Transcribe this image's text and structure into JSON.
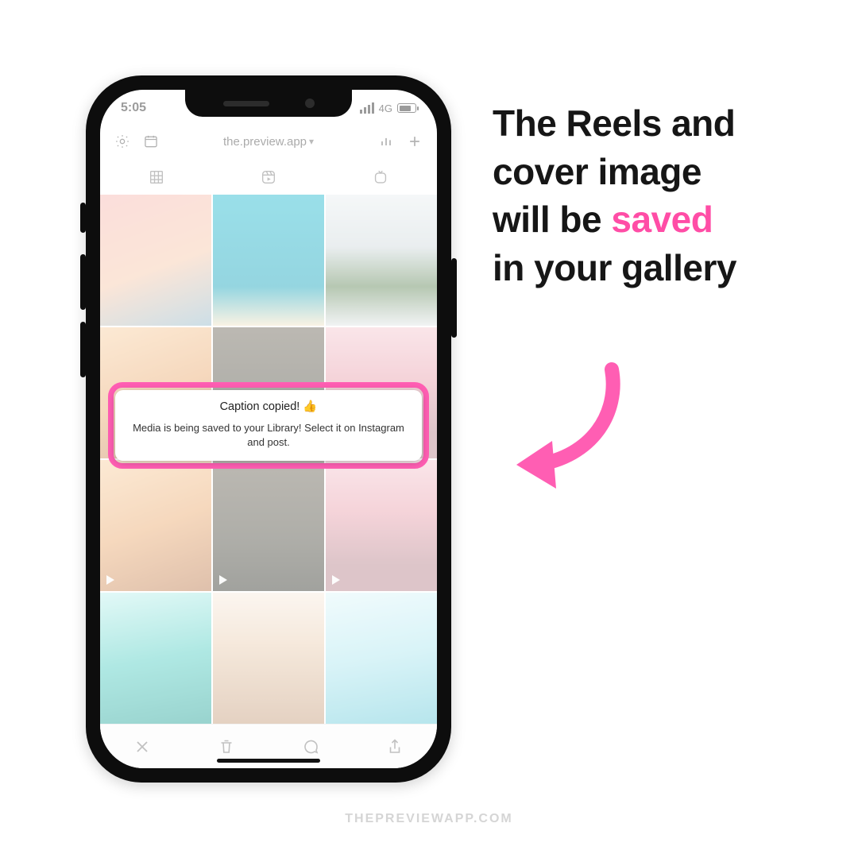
{
  "caption": {
    "line1": "The Reels and",
    "line2": "cover image",
    "line3_prefix": "will be ",
    "line3_highlight": "saved",
    "line4": "in your gallery"
  },
  "colors": {
    "accent_pink": "#ff4da6",
    "highlight_border": "#ff5eb3"
  },
  "status": {
    "time": "5:05",
    "network": "4G"
  },
  "header": {
    "account": "the.preview.app"
  },
  "toast": {
    "title": "Caption copied! 👍",
    "body": "Media is being saved to your Library! Select it on Instagram and post."
  },
  "tabs": {
    "grid_label": "grid",
    "reels_label": "reels",
    "igtv_label": "igtv"
  },
  "toolbar": {
    "close": "close",
    "delete": "delete",
    "comment": "comment",
    "share": "share"
  },
  "grid": {
    "rows_with_play_indicator": [
      2
    ]
  },
  "watermark": "THEPREVIEWAPP.COM"
}
